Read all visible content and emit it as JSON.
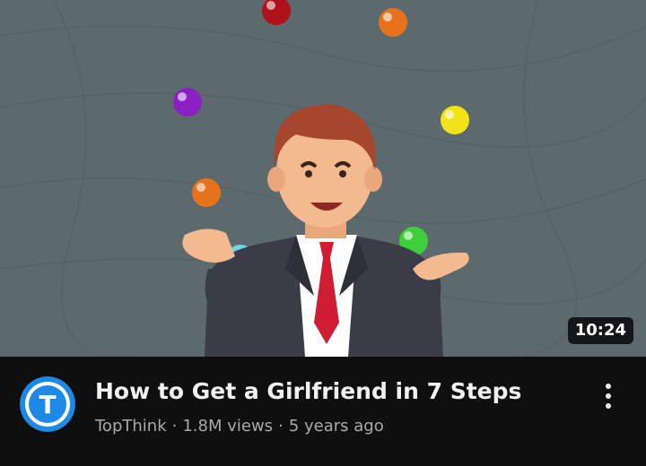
{
  "video": {
    "title": "How to Get a Girlfriend in 7 Steps",
    "duration": "10:24",
    "channel": "TopThink",
    "views": "1.8M views",
    "age": "5 years ago",
    "separator": "·",
    "thumbnail_description": "cartoon-businessman-juggling-balls",
    "avatar_icon": "topthink-logo-icon",
    "avatar_letter": "T",
    "more_icon": "three-dots-vertical-icon"
  },
  "colors": {
    "page_background": "#0f0f0f",
    "thumbnail_background": "#5d6a6d",
    "title_text": "#f1f1f1",
    "secondary_text": "#aaaaaa",
    "avatar_blue": "#1e88e5",
    "duration_badge": "#000000"
  }
}
